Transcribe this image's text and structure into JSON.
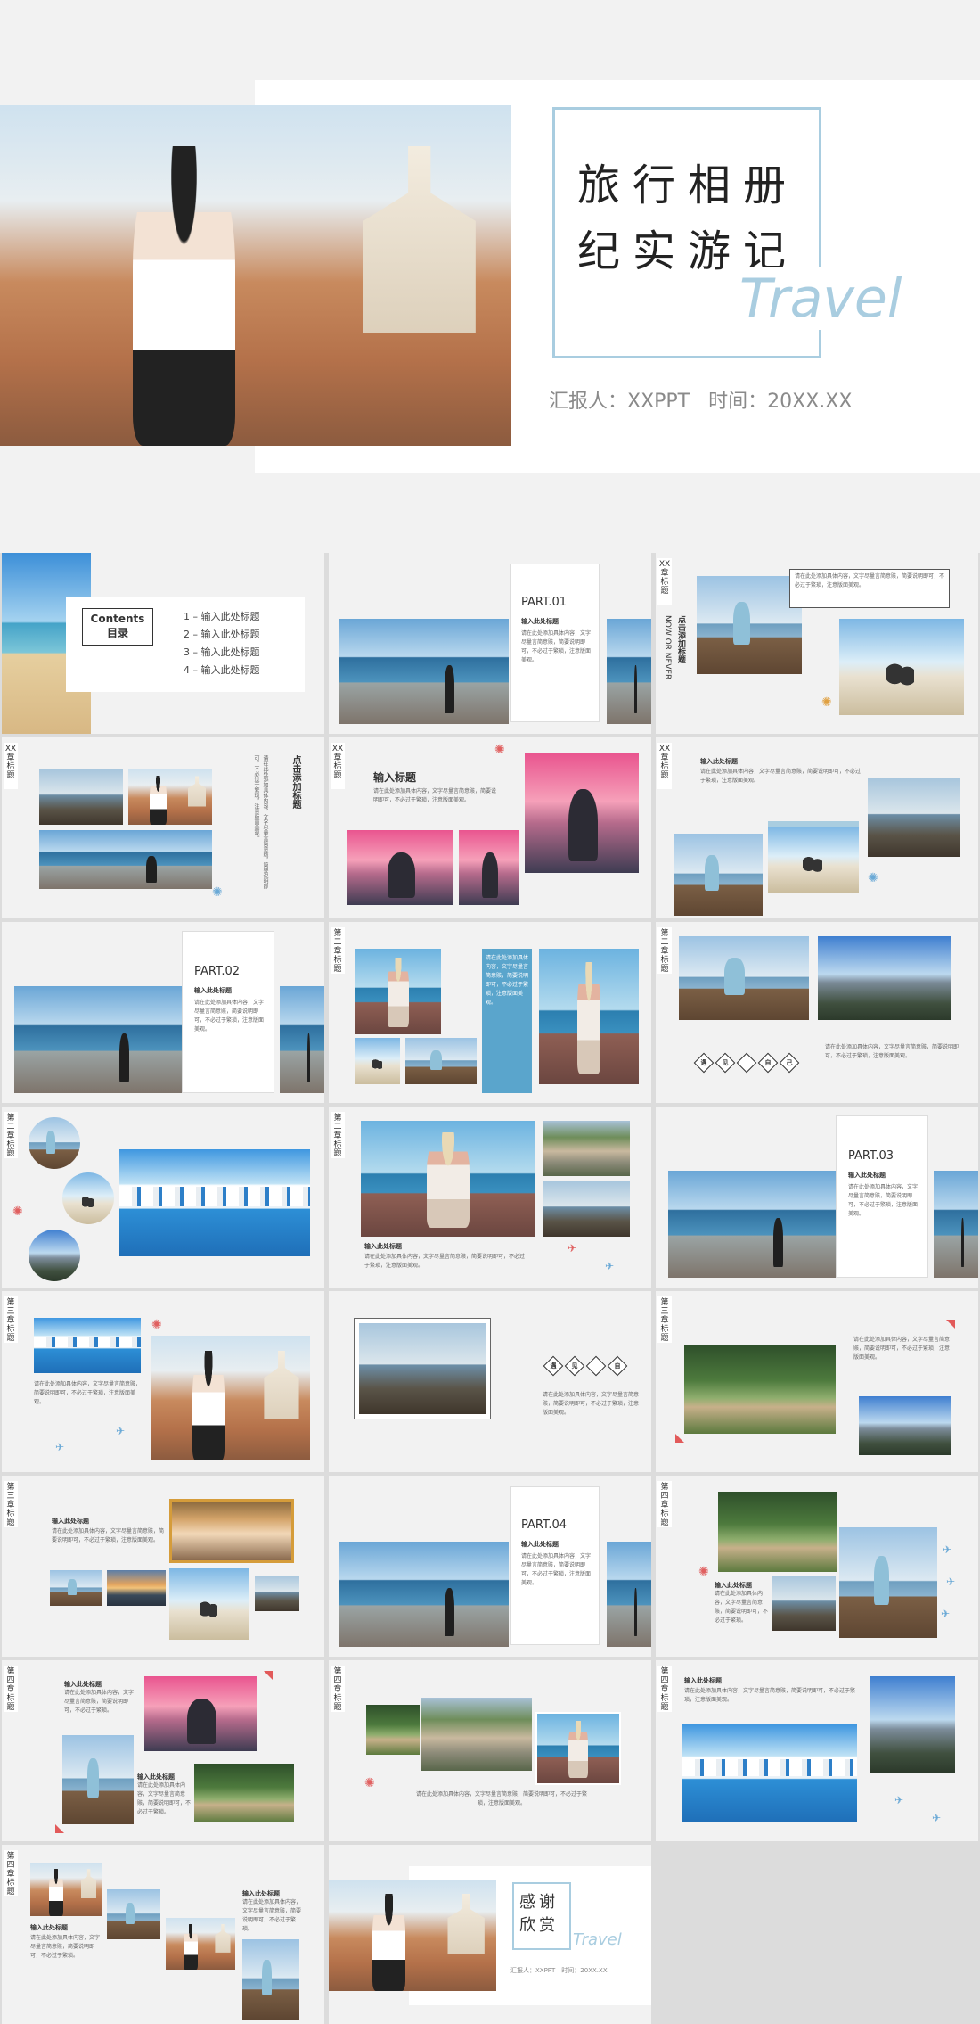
{
  "cover": {
    "title_line1": "旅行相册",
    "title_line2": "纪实游记",
    "title_en": "Travel",
    "reporter": "汇报人：XXPPT",
    "time": "时间：20XX.XX",
    "accent": "#a9cde0"
  },
  "contents": {
    "heading_en": "Contents",
    "heading_cn": "目录",
    "items": [
      "1 – 输入此处标题",
      "2 – 输入此处标题",
      "3 – 输入此处标题",
      "4 – 输入此处标题"
    ]
  },
  "parts": {
    "p1": "PART.01",
    "p2": "PART.02",
    "p3": "PART.03",
    "p4": "PART.04",
    "sub": "输入此处标题"
  },
  "chapters": {
    "xx": "XX章标题",
    "c2": "第二章标题",
    "c3": "第三章标题",
    "c4": "第四章标题"
  },
  "labels": {
    "click_title": "点击添加标题",
    "now_or_never": "NOW OR NEVER",
    "input_title": "输入标题",
    "input_here": "输入此处标题",
    "body": "请在此处添加具体内容，文字尽量言简意赅，简要说明即可，不必过于繁琐，注意版面美观。",
    "body_short": "请在此处添加具体内容，文字尽量言简意赅，简要说明即可，不必过于繁琐。",
    "diamonds": [
      "遇",
      "见",
      "自",
      "己"
    ]
  },
  "thanks": {
    "line1": "感谢",
    "line2": "欣赏",
    "en": "Travel",
    "footer": "汇报人：XXPPT　时间：20XX.XX"
  }
}
